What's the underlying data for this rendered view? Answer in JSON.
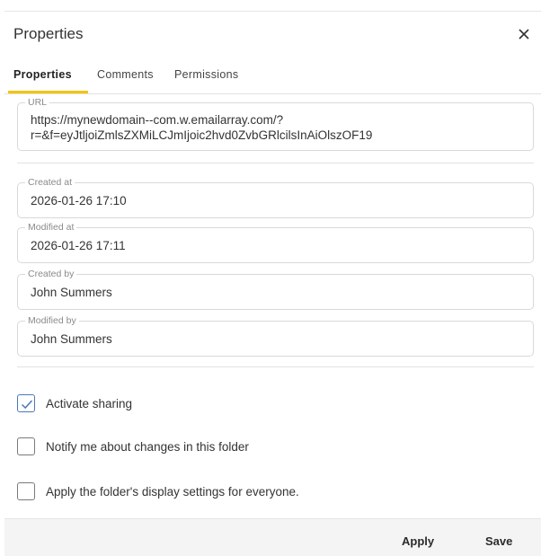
{
  "dialog": {
    "title": "Properties",
    "close_icon": "close-icon"
  },
  "tabs": [
    {
      "label": "Properties",
      "active": true
    },
    {
      "label": "Comments",
      "active": false
    },
    {
      "label": "Permissions",
      "active": false
    }
  ],
  "url_field": {
    "label": "URL",
    "value_line1": "https://mynewdomain--com.w.emailarray.com/?",
    "value_line2": "r=&f=eyJtljoiZmlsZXMiLCJmIjoic2hvd0ZvbGRlcilsInAiOlszOF19"
  },
  "fields": [
    {
      "label": "Created at",
      "value": "2026-01-26 17:10"
    },
    {
      "label": "Modified at",
      "value": "2026-01-26 17:11"
    },
    {
      "label": "Created by",
      "value": "John Summers"
    },
    {
      "label": "Modified by",
      "value": "John Summers"
    }
  ],
  "checkboxes": [
    {
      "label": "Activate sharing",
      "checked": true
    },
    {
      "label": "Notify me about changes in this folder",
      "checked": false
    },
    {
      "label": "Apply the folder's display settings for everyone.",
      "checked": false
    }
  ],
  "footer": {
    "apply_label": "Apply",
    "save_label": "Save"
  },
  "colors": {
    "tab_accent": "#f5c400",
    "checkbox_accent": "#4a78b8"
  }
}
